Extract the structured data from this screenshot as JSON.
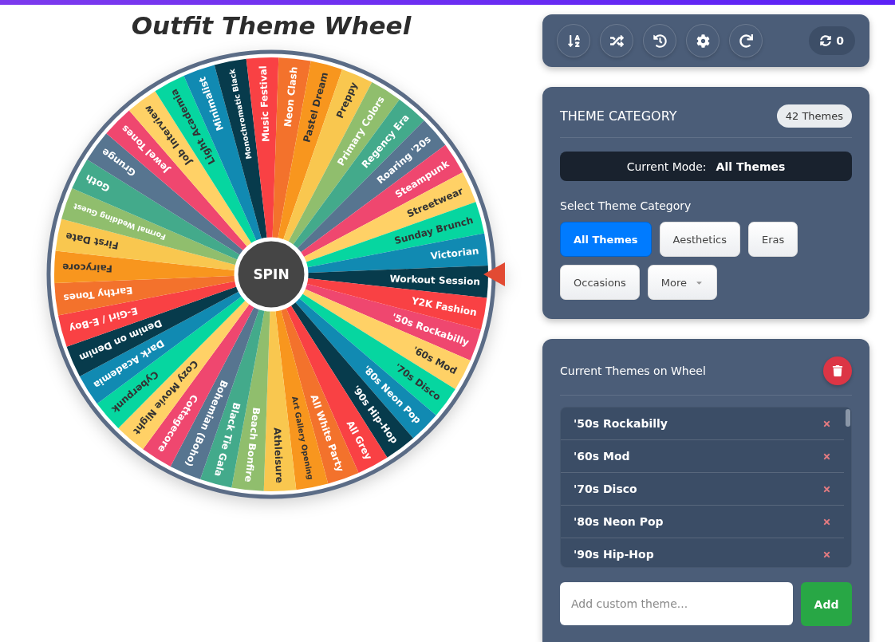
{
  "title": "Outfit Theme Wheel",
  "wheel": {
    "spin_label": "SPIN",
    "segments": [
      {
        "label": "'50s Rockabilly"
      },
      {
        "label": "'60s Mod"
      },
      {
        "label": "'70s Disco"
      },
      {
        "label": "'80s Neon Pop"
      },
      {
        "label": "'90s Hip-Hop"
      },
      {
        "label": "All Grey"
      },
      {
        "label": "All White Party"
      },
      {
        "label": "Art Gallery Opening"
      },
      {
        "label": "Athleisure"
      },
      {
        "label": "Beach Bonfire"
      },
      {
        "label": "Black Tie Gala"
      },
      {
        "label": "Bohemian (Boho)"
      },
      {
        "label": "Cottagecore"
      },
      {
        "label": "Cozy Movie Night"
      },
      {
        "label": "Cyberpunk"
      },
      {
        "label": "Dark Academia"
      },
      {
        "label": "Denim on Denim"
      },
      {
        "label": "E-Girl / E-Boy"
      },
      {
        "label": "Earthy Tones"
      },
      {
        "label": "Fairycore"
      },
      {
        "label": "First Date"
      },
      {
        "label": "Formal Wedding Guest"
      },
      {
        "label": "Goth"
      },
      {
        "label": "Grunge"
      },
      {
        "label": "Jewel Tones"
      },
      {
        "label": "Job Interview"
      },
      {
        "label": "Light Academia"
      },
      {
        "label": "Minimalist"
      },
      {
        "label": "Monochromatic Black"
      },
      {
        "label": "Music Festival"
      },
      {
        "label": "Neon Clash"
      },
      {
        "label": "Pastel Dream"
      },
      {
        "label": "Preppy"
      },
      {
        "label": "Primary Colors"
      },
      {
        "label": "Regency Era"
      },
      {
        "label": "Roaring '20s"
      },
      {
        "label": "Steampunk"
      },
      {
        "label": "Streetwear"
      },
      {
        "label": "Sunday Brunch"
      },
      {
        "label": "Victorian"
      },
      {
        "label": "Workout Session"
      },
      {
        "label": "Y2K Fashion"
      }
    ]
  },
  "toolbar": {
    "spin_count": "0"
  },
  "category_panel": {
    "heading": "THEME CATEGORY",
    "count_badge": "42 Themes",
    "mode_label": "Current Mode:",
    "mode_value": "All Themes",
    "select_label": "Select Theme Category",
    "categories": [
      {
        "label": "All Themes",
        "selected": true,
        "kind": "plain"
      },
      {
        "label": "Aesthetics",
        "selected": false,
        "kind": "plain"
      },
      {
        "label": "Eras",
        "selected": false,
        "kind": "plain"
      },
      {
        "label": "Occasions",
        "selected": false,
        "kind": "plain"
      },
      {
        "label": "More",
        "selected": false,
        "kind": "dropdown"
      }
    ]
  },
  "themes_panel": {
    "heading": "Current Themes on Wheel",
    "items": [
      "'50s Rockabilly",
      "'60s Mod",
      "'70s Disco",
      "'80s Neon Pop",
      "'90s Hip-Hop"
    ],
    "input_placeholder": "Add custom theme...",
    "add_label": "Add"
  }
}
